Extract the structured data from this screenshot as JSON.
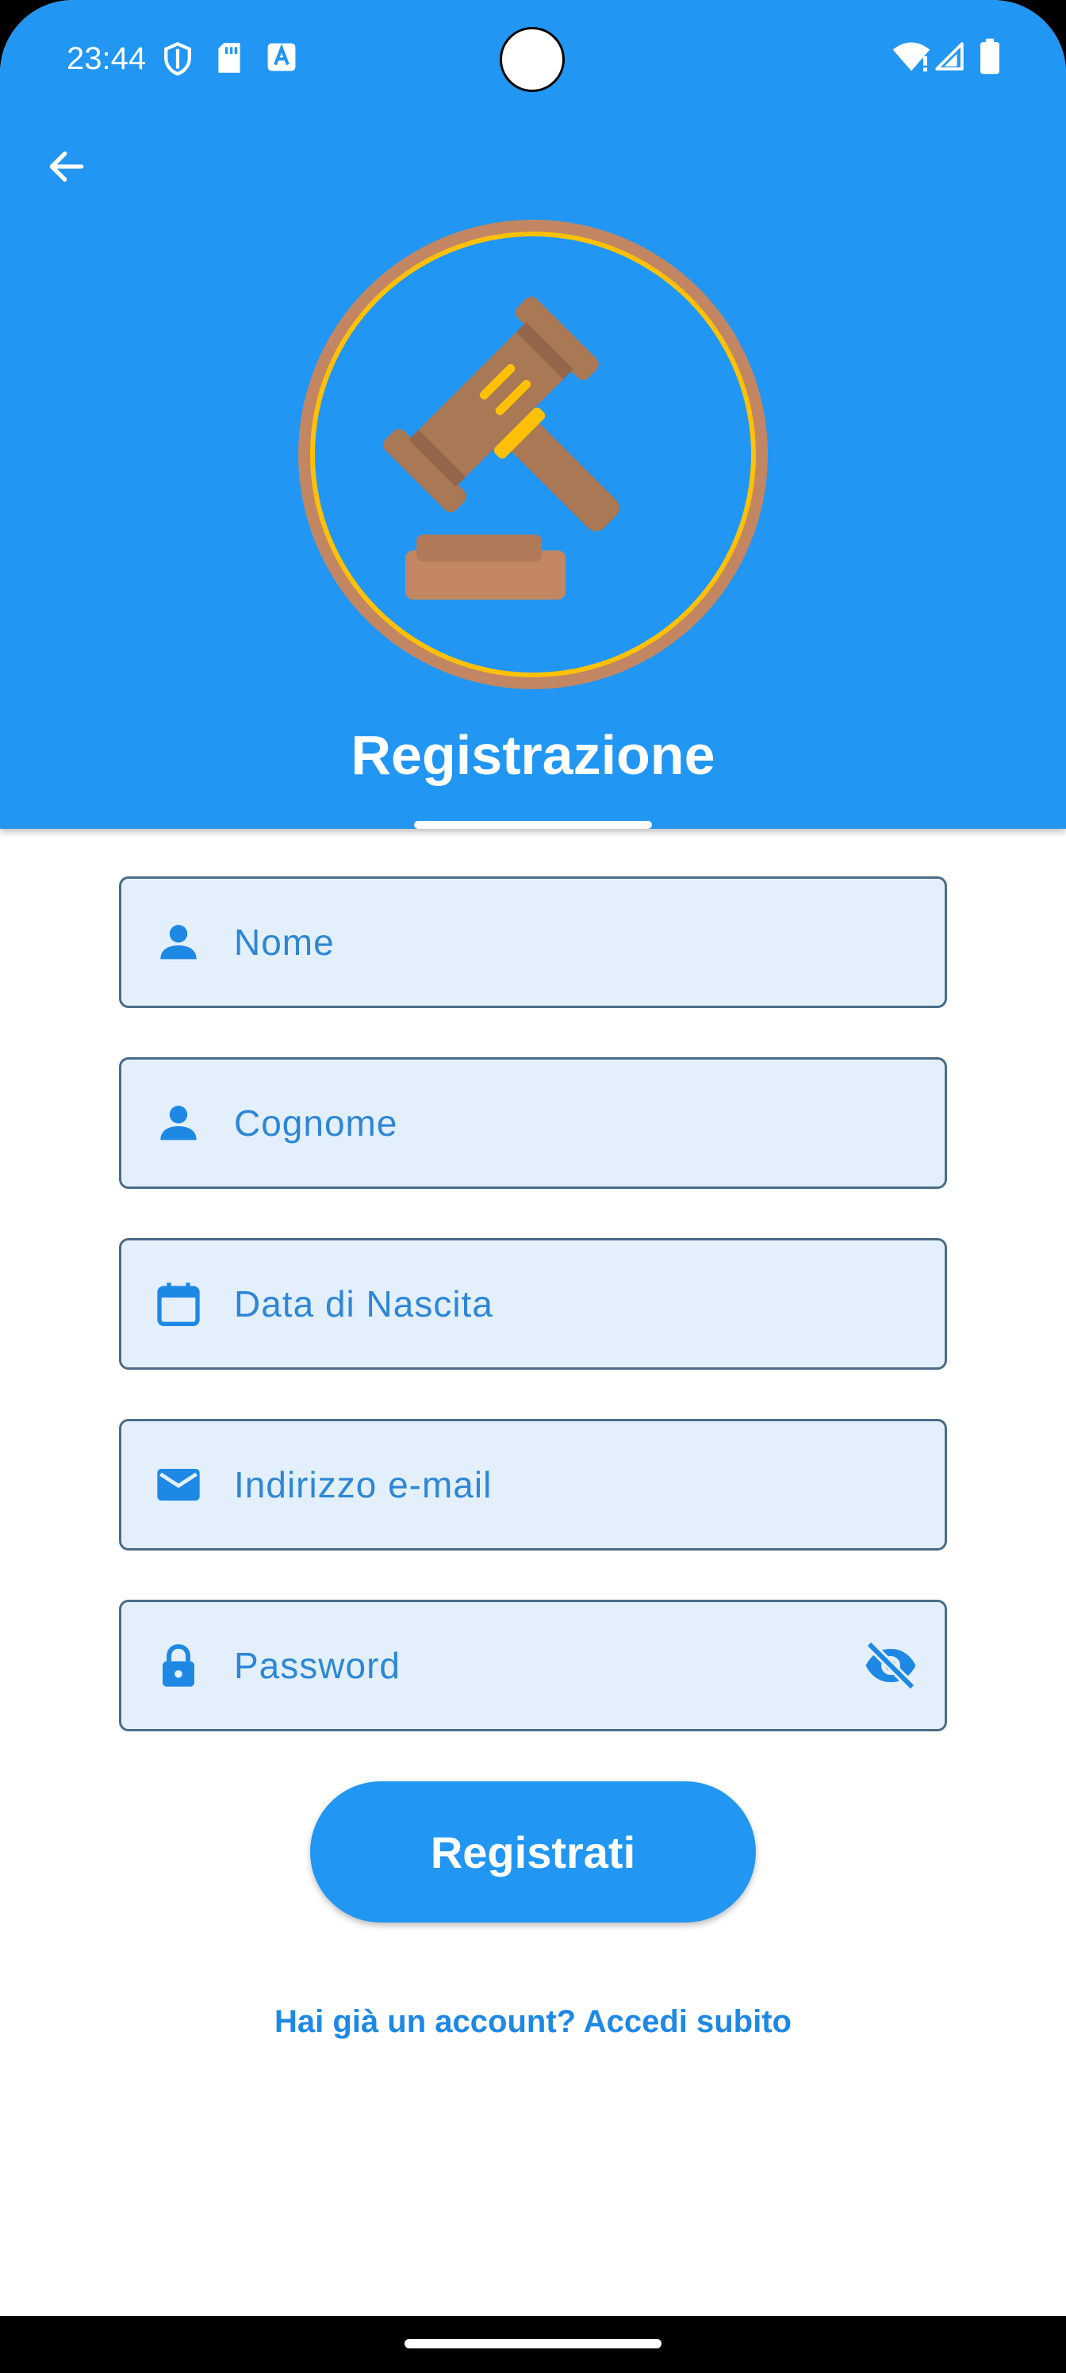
{
  "status_bar": {
    "time": "23:44",
    "left_icons": [
      "shield-icon",
      "sd-card-icon",
      "text-a-icon"
    ],
    "right_icons": [
      "wifi-icon",
      "signal-icon",
      "battery-icon"
    ]
  },
  "header": {
    "title": "Registrazione",
    "background": "#2196F3",
    "logo": "gavel-icon"
  },
  "form": {
    "nome": {
      "placeholder": "Nome",
      "value": "",
      "icon": "person-icon"
    },
    "cognome": {
      "placeholder": "Cognome",
      "value": "",
      "icon": "person-icon"
    },
    "data_nascita": {
      "placeholder": "Data di Nascita",
      "value": "",
      "icon": "calendar-icon"
    },
    "email": {
      "placeholder": "Indirizzo e-mail",
      "value": "",
      "icon": "mail-icon"
    },
    "password": {
      "placeholder": "Password",
      "value": "",
      "icon": "lock-icon",
      "toggle_icon": "visibility-off-icon"
    }
  },
  "actions": {
    "register_label": "Registrati",
    "login_link": "Hai già un account? Accedi subito"
  },
  "colors": {
    "primary": "#2196F3",
    "field_background": "#E3F0FB",
    "field_border": "#4B6C87",
    "logo_ring_outer": "#C28762",
    "logo_ring_inner": "#FFC107",
    "gavel_wood": "#A97855"
  }
}
